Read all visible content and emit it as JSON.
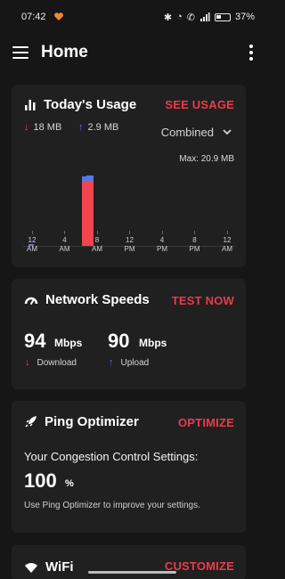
{
  "status": {
    "time": "07:42",
    "battery": "37%"
  },
  "app_bar": {
    "title": "Home"
  },
  "usage_card": {
    "title": "Today's Usage",
    "action": "SEE USAGE",
    "download_total": "18 MB",
    "upload_total": "2.9 MB",
    "mode": "Combined",
    "max": "Max: 20.9 MB",
    "ticks": [
      {
        "top": "12",
        "bottom": "AM"
      },
      {
        "top": "4",
        "bottom": "AM"
      },
      {
        "top": "8",
        "bottom": "AM"
      },
      {
        "top": "12",
        "bottom": "PM"
      },
      {
        "top": "4",
        "bottom": "PM"
      },
      {
        "top": "8",
        "bottom": "PM"
      },
      {
        "top": "12",
        "bottom": "AM"
      }
    ],
    "chart_data": {
      "type": "bar",
      "max_mb": 20.9,
      "series": [
        {
          "name": "Download",
          "values": [
            0.4,
            17.4,
            17.5
          ]
        },
        {
          "name": "Upload",
          "values": [
            0.2,
            1.4,
            1.6
          ]
        }
      ],
      "bar_hours": [
        0,
        6.4,
        7.0
      ]
    }
  },
  "speed_card": {
    "title": "Network Speeds",
    "action": "TEST NOW",
    "download": {
      "value": "94",
      "unit": "Mbps",
      "label": "Download"
    },
    "upload": {
      "value": "90",
      "unit": "Mbps",
      "label": "Upload"
    }
  },
  "ping_card": {
    "title": "Ping Optimizer",
    "action": "OPTIMIZE",
    "setting_label": "Your Congestion Control Settings:",
    "value": "100",
    "unit": "%",
    "note": "Use Ping Optimizer to improve your settings."
  },
  "wifi_card": {
    "title": "WiFi",
    "action": "CUSTOMIZE"
  },
  "colors": {
    "accent": "#ea3b4a",
    "download": "#f3454f",
    "upload": "#5577e8",
    "background": "#161616",
    "card": "#202020"
  }
}
